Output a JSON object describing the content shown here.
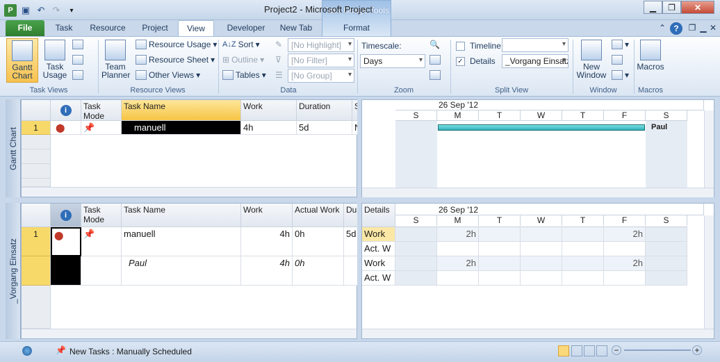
{
  "window": {
    "title": "Project2 - Microsoft Project",
    "context_tab_group": "Task Usage Tools"
  },
  "tabs": [
    {
      "label": "File"
    },
    {
      "label": "Task"
    },
    {
      "label": "Resource"
    },
    {
      "label": "Project"
    },
    {
      "label": "View"
    },
    {
      "label": "Developer"
    },
    {
      "label": "New Tab"
    },
    {
      "label": "Format"
    }
  ],
  "ribbon": {
    "task_views": {
      "label": "Task Views",
      "gantt_chart": "Gantt Chart",
      "task_usage": "Task Usage"
    },
    "resource_views": {
      "label": "Resource Views",
      "team_planner": "Team Planner",
      "resource_usage": "Resource Usage",
      "resource_sheet": "Resource Sheet",
      "other_views": "Other Views"
    },
    "data": {
      "label": "Data",
      "sort": "Sort",
      "outline": "Outline",
      "tables": "Tables",
      "highlight": "[No Highlight]",
      "filter": "[No Filter]",
      "group": "[No Group]"
    },
    "zoom": {
      "label": "Zoom",
      "timescale_label": "Timescale:",
      "timescale_value": "Days"
    },
    "split_view": {
      "label": "Split View",
      "timeline": "Timeline",
      "timeline_checked": false,
      "details": "Details",
      "details_checked": true,
      "details_view": "_Vorgang Einsatz"
    },
    "window": {
      "label": "Window",
      "new_window": "New Window"
    },
    "macros": {
      "label": "Macros",
      "macros": "Macros"
    }
  },
  "top_pane": {
    "side_label": "Gantt Chart",
    "columns": [
      "Task Mode",
      "Task Name",
      "Work",
      "Duration",
      "S"
    ],
    "rows": [
      {
        "id": "1",
        "task_name": "manuell",
        "work": "4h",
        "duration": "5d",
        "s": "N"
      }
    ],
    "timescale": {
      "week_label": "26 Sep '12",
      "days": [
        "S",
        "M",
        "T",
        "W",
        "T",
        "F",
        "S"
      ]
    },
    "bar_label": "Paul"
  },
  "bottom_pane": {
    "side_label": "_Vorgang Einsatz",
    "columns": [
      "Task Mode",
      "Task Name",
      "Work",
      "Actual Work",
      "Du"
    ],
    "rows": [
      {
        "id": "1",
        "task_name": "manuell",
        "work": "4h",
        "actual_work": "0h",
        "duration": "5d"
      },
      {
        "id": "",
        "task_name": "Paul",
        "work": "4h",
        "actual_work": "0h",
        "duration": ""
      }
    ],
    "details_header": "Details",
    "timescale": {
      "week_label": "26 Sep '12",
      "days": [
        "S",
        "M",
        "T",
        "W",
        "T",
        "F",
        "S"
      ]
    },
    "detail_rows": [
      {
        "label": "Work",
        "values": [
          "",
          "2h",
          "",
          "",
          "",
          "2h",
          ""
        ]
      },
      {
        "label": "Act. W",
        "values": [
          "",
          "",
          "",
          "",
          "",
          "",
          ""
        ]
      },
      {
        "label": "Work",
        "values": [
          "",
          "2h",
          "",
          "",
          "",
          "2h",
          ""
        ]
      },
      {
        "label": "Act. W",
        "values": [
          "",
          "",
          "",
          "",
          "",
          "",
          ""
        ]
      }
    ]
  },
  "status": {
    "new_tasks": "New Tasks : Manually Scheduled"
  }
}
